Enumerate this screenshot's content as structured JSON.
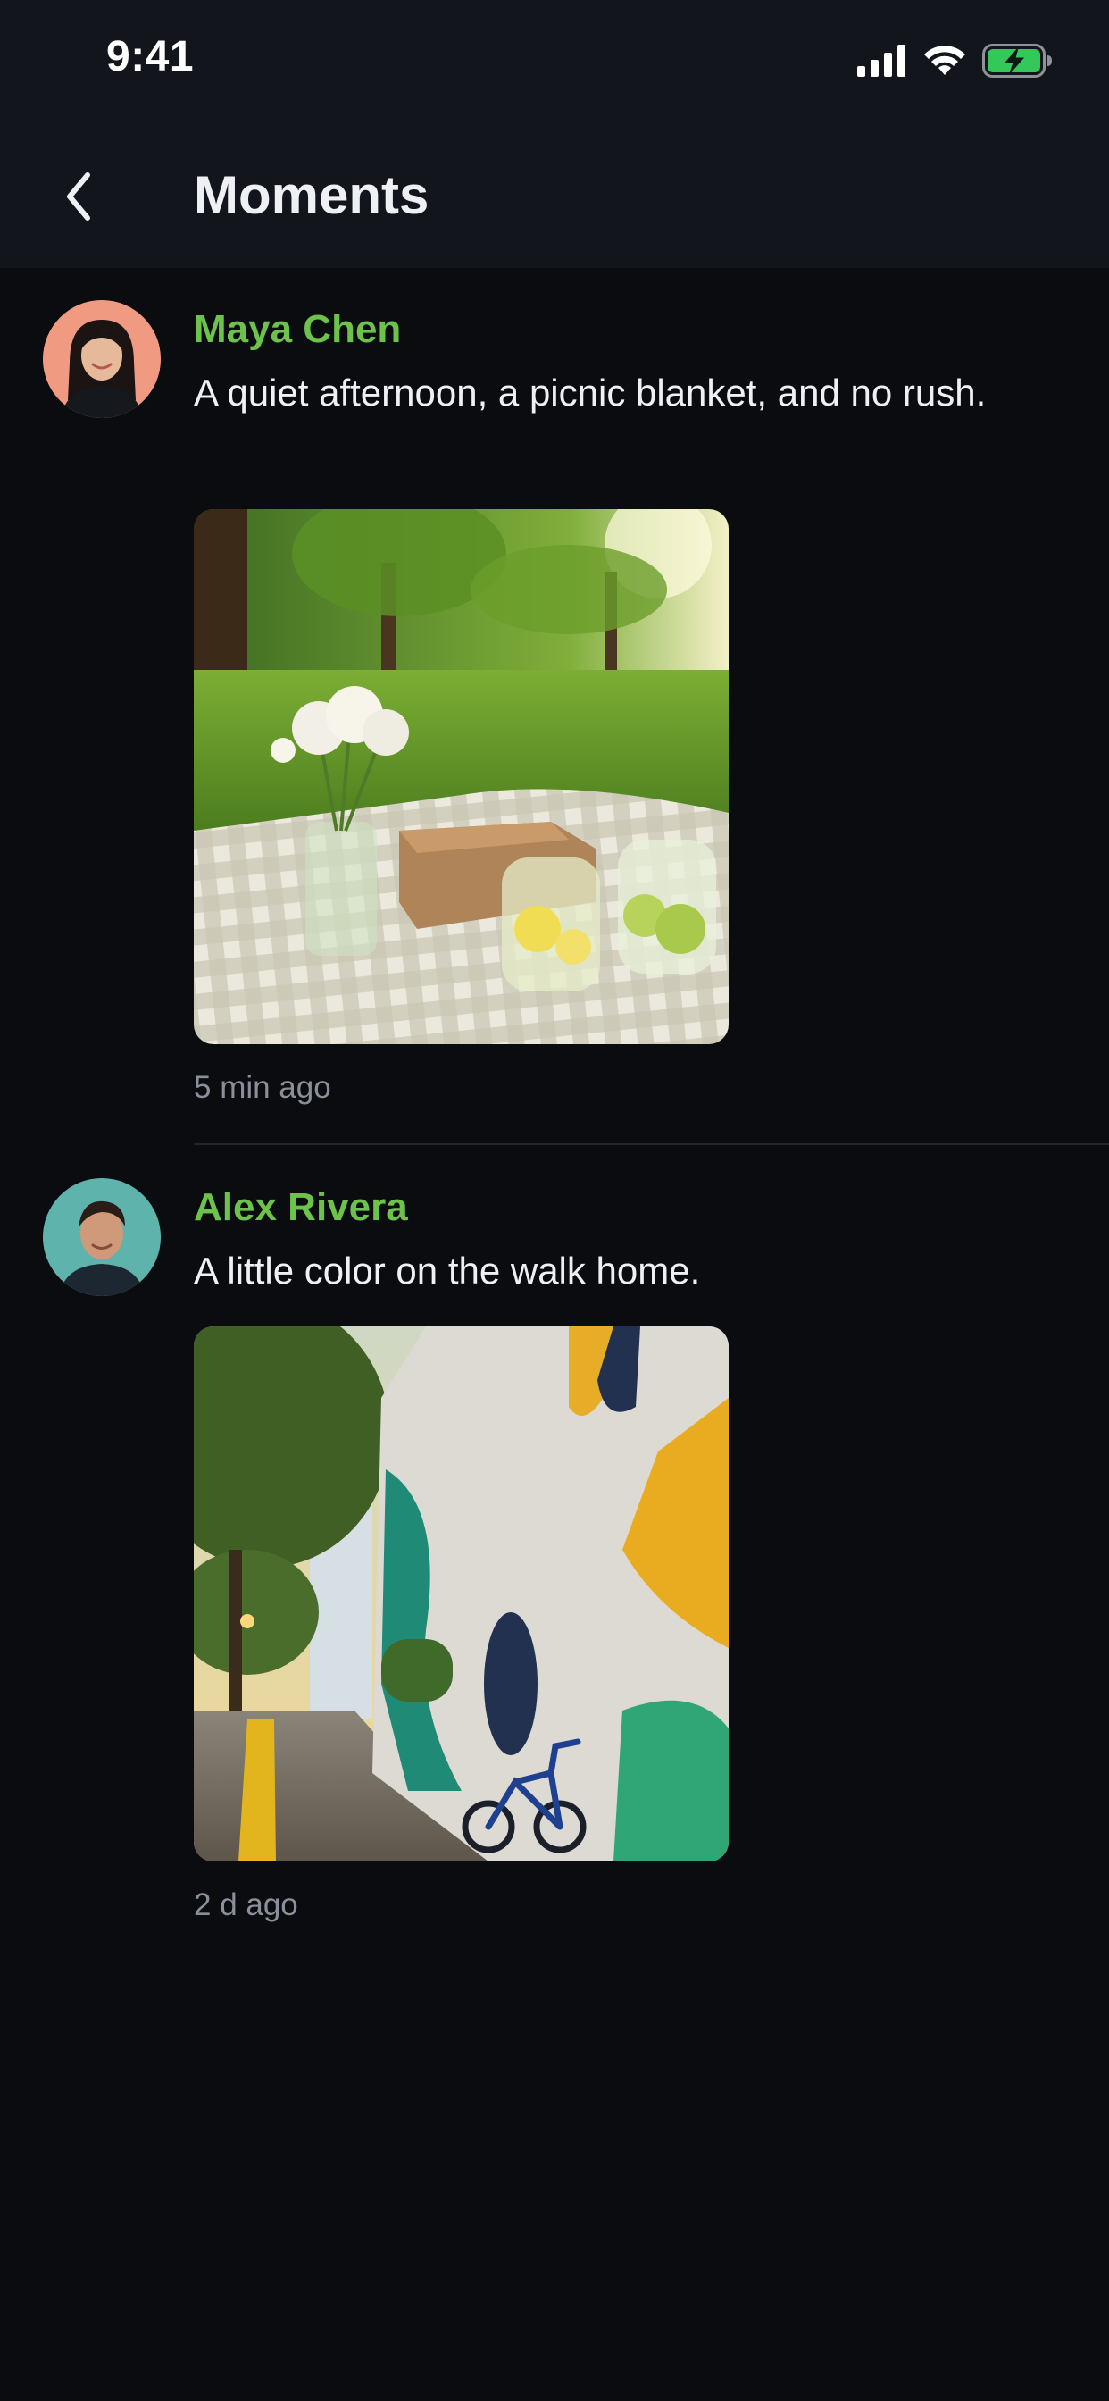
{
  "status_bar": {
    "time": "9:41",
    "icons": [
      "cellular-signal-icon",
      "wifi-icon",
      "battery-charging-icon"
    ],
    "battery_color": "#34c759"
  },
  "nav": {
    "title": "Moments",
    "back_icon": "chevron-left-icon"
  },
  "colors": {
    "accent": "#6cc24a",
    "background": "#0a0c10",
    "header": "#12151b"
  },
  "posts": [
    {
      "author": "Maya Chen",
      "text": "A quiet afternoon, a picnic blanket, and no rush.",
      "time": "5 min ago",
      "photo": "picnic-photo"
    },
    {
      "author": "Alex Rivera",
      "text": "A little color on the walk home.",
      "time": "2 d ago",
      "photo": "mural-photo"
    }
  ]
}
